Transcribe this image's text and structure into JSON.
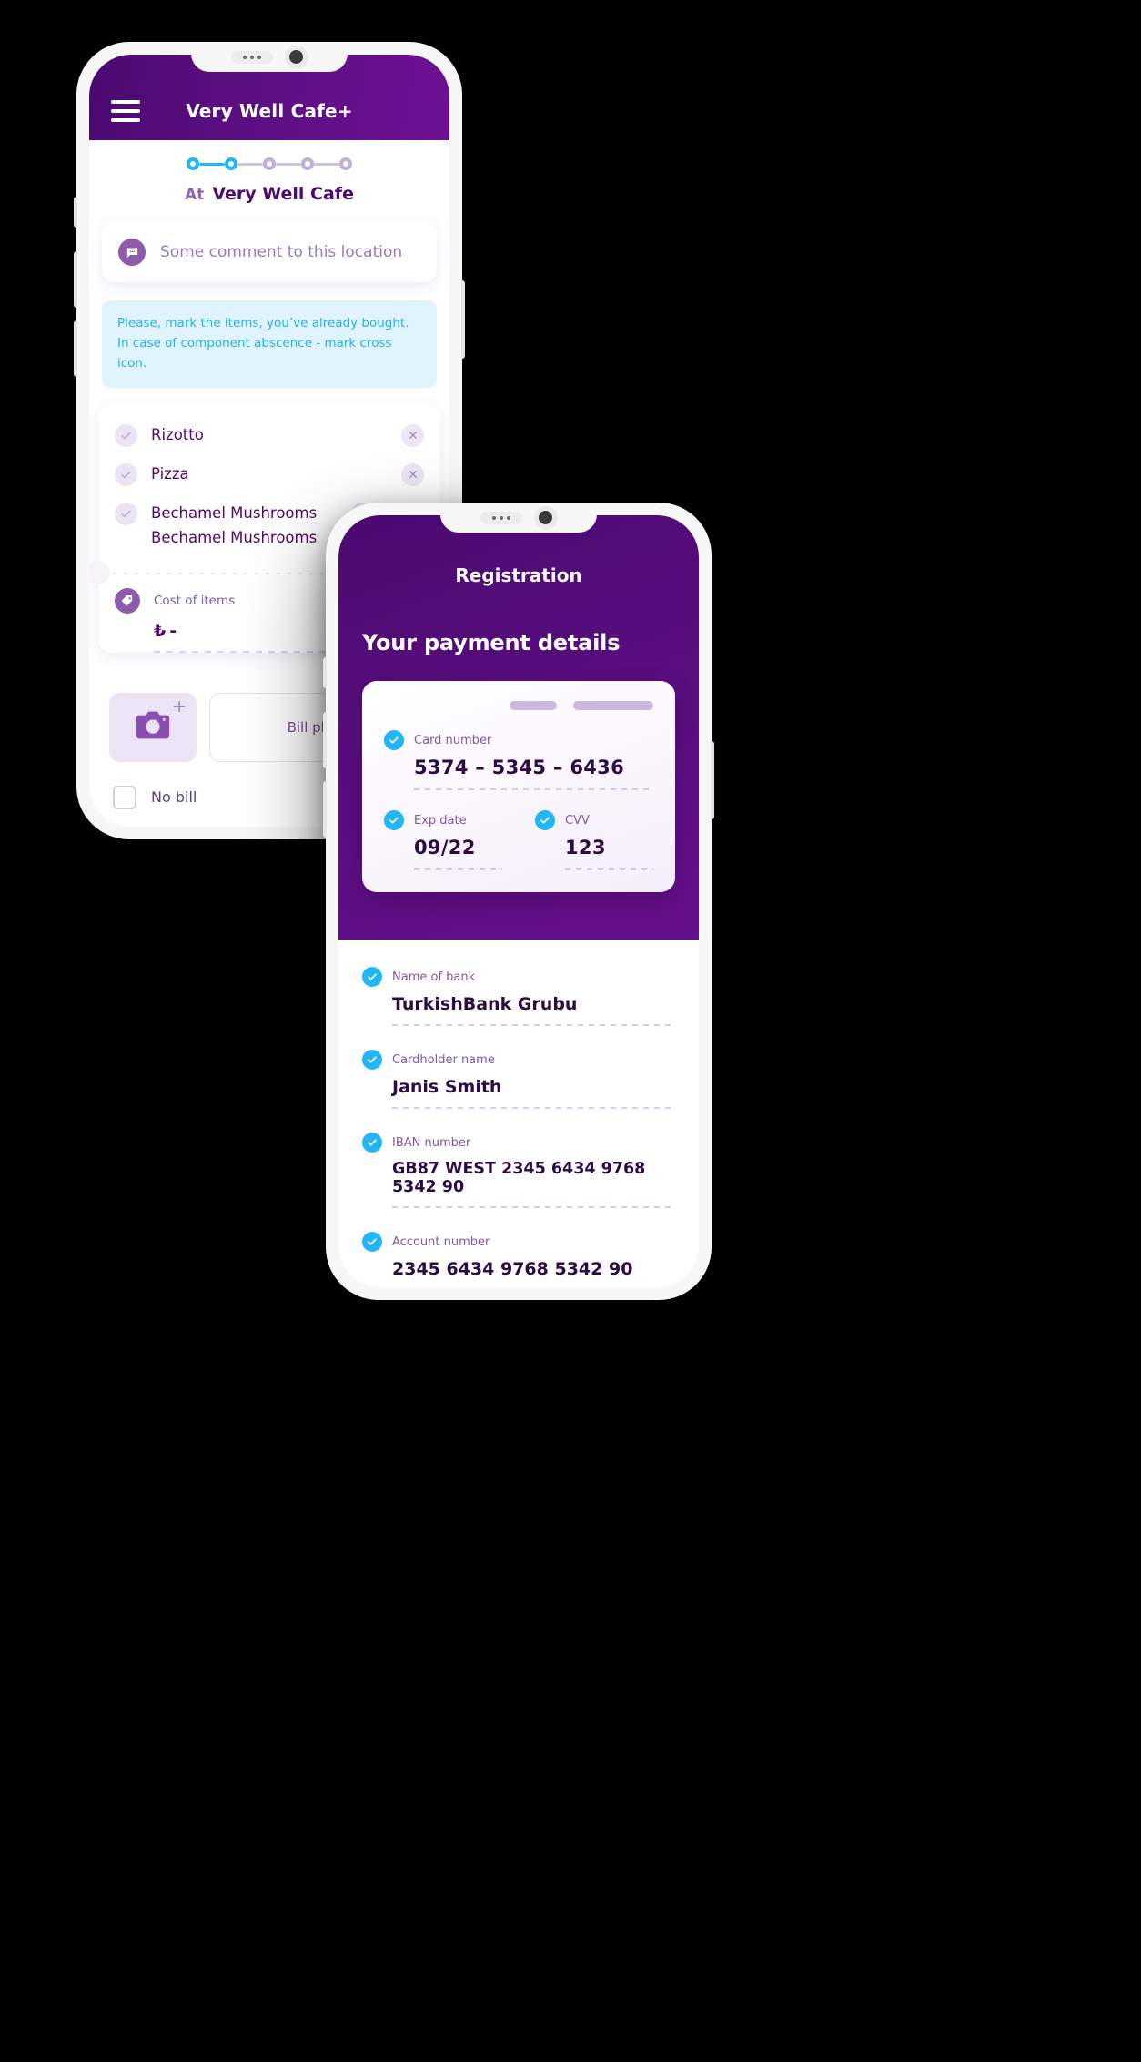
{
  "phone1": {
    "header": {
      "title": "Very Well Cafe+",
      "menu_icon": "hamburger-menu-icon"
    },
    "stepper": {
      "steps": [
        {
          "state": "active"
        },
        {
          "state": "active"
        },
        {
          "state": "inactive"
        },
        {
          "state": "inactive"
        },
        {
          "state": "inactive"
        }
      ],
      "active_color": "#21b6f5",
      "inactive_color": "#bfb0d8"
    },
    "location": {
      "prefix": "At",
      "name": "Very Well Cafe"
    },
    "comment": {
      "icon": "chat-bubble-icon",
      "placeholder": "Some comment to this location",
      "value": ""
    },
    "info_box": {
      "text": "Please, mark the items, you’ve already bought. In case of component abscence - mark cross icon.",
      "bg": "#e1f4fd",
      "fg": "#1fb2f0"
    },
    "items": [
      {
        "name": "Rizotto",
        "checked": false
      },
      {
        "name": "Pizza",
        "checked": false
      },
      {
        "name": "Bechamel Mushrooms Bechamel Mushrooms",
        "checked": false
      }
    ],
    "cost": {
      "icon": "price-tag-icon",
      "label": "Cost of items",
      "currency": "₺",
      "value": "-"
    },
    "photo": {
      "camera_icon": "camera-icon",
      "plus": "+",
      "bill_label": "Bill photo"
    },
    "no_bill": {
      "label": "No bill",
      "checked": false
    }
  },
  "phone2": {
    "header": {
      "title": "Registration"
    },
    "subtitle": "Your payment details",
    "card": {
      "number_label": "Card number",
      "number_value": "5374 – 5345 – 6436",
      "exp_label": "Exp date",
      "exp_value": "09/22",
      "cvv_label": "CVV",
      "cvv_value": "123"
    },
    "fields": [
      {
        "label": "Name of bank",
        "value": "TurkishBank Grubu"
      },
      {
        "label": "Cardholder name",
        "value": "Janis Smith"
      },
      {
        "label": "IBAN number",
        "value": "GB87 WEST 2345 6434 9768 5342 90"
      },
      {
        "label": "Account number",
        "value": "2345 6434 9768 5342 90"
      }
    ]
  }
}
